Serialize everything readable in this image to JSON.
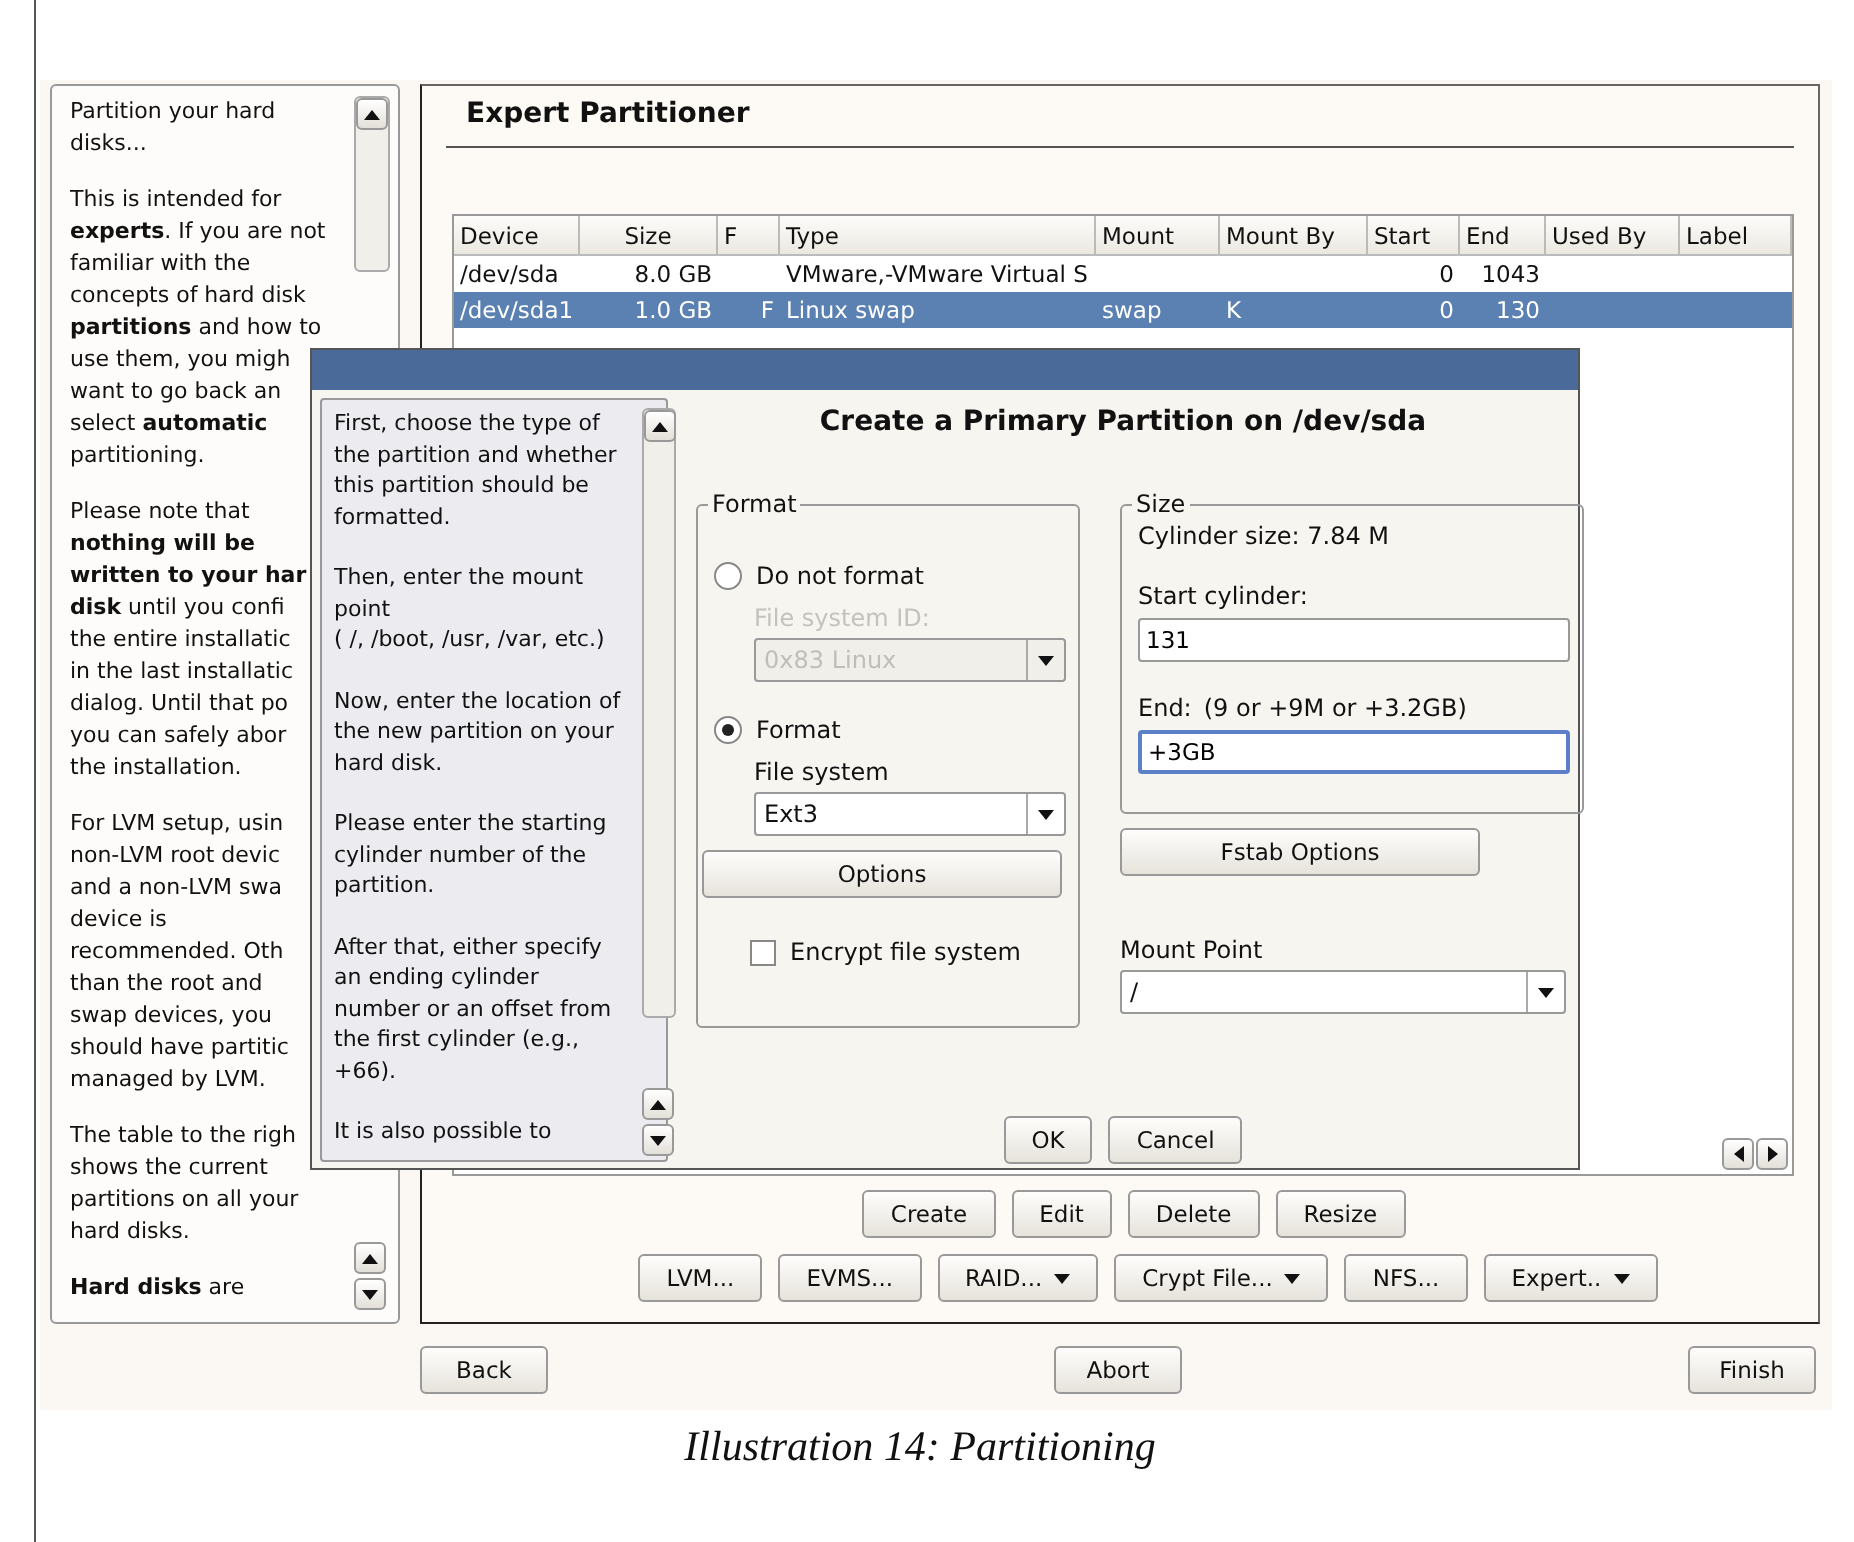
{
  "help": {
    "paragraphs": [
      [
        "Partition your hard",
        "disks..."
      ],
      [
        "This is intended for",
        "**experts**. If you are not",
        "familiar with the",
        "concepts of hard disk",
        "**partitions** and how to",
        "use them, you migh",
        "want to go back an",
        "select **automatic**",
        "partitioning."
      ],
      [
        "Please note that",
        "**nothing will be**",
        "**written to your har**",
        "**disk** until you confi",
        "the entire installatic",
        "in the last installatic",
        "dialog. Until that po",
        "you can safely abor",
        "the installation."
      ],
      [
        "For LVM setup, usin",
        "non-LVM root devic",
        "and a non-LVM swa",
        "device is",
        "recommended. Oth",
        "than the root and",
        "swap devices, you",
        "should have partitic",
        "managed by LVM."
      ],
      [
        "The table to the righ",
        "shows the current",
        "partitions on all your",
        "hard disks."
      ],
      [
        "**Hard disks** are"
      ]
    ]
  },
  "main": {
    "title": "Expert Partitioner",
    "table": {
      "columns": [
        "Device",
        "Size",
        "F",
        "Type",
        "Mount",
        "Mount By",
        "Start",
        "End",
        "Used By",
        "Label"
      ],
      "rows": [
        {
          "cells": [
            "/dev/sda",
            "8.0 GB",
            null,
            "VMware,-VMware Virtual S",
            null,
            null,
            "0",
            "1043",
            null,
            null
          ],
          "selected": false
        },
        {
          "cells": [
            "/dev/sda1",
            "1.0 GB",
            "F",
            "Linux swap",
            "swap",
            "K",
            "0",
            "130",
            null,
            null
          ],
          "selected": true
        }
      ]
    },
    "action_buttons": [
      {
        "label": "Create"
      },
      {
        "label": "Edit"
      },
      {
        "label": "Delete"
      },
      {
        "label": "Resize"
      }
    ],
    "tool_buttons": [
      {
        "label": "LVM...",
        "menu": false
      },
      {
        "label": "EVMS...",
        "menu": false
      },
      {
        "label": "RAID...",
        "menu": true
      },
      {
        "label": "Crypt File...",
        "menu": true
      },
      {
        "label": "NFS...",
        "menu": false
      },
      {
        "label": "Expert..",
        "menu": true
      }
    ]
  },
  "nav_buttons": [
    {
      "label": "Back"
    },
    {
      "label": "Abort"
    },
    {
      "label": "Finish"
    }
  ],
  "dialog": {
    "heading": "Create a Primary Partition on /dev/sda",
    "help": {
      "paragraphs": [
        "First, choose the type of the partition and whether this partition should be formatted.",
        "Then, enter the mount point\n( /, /boot, /usr, /var, etc.)",
        "Now, enter the location of the new partition on your hard disk.",
        "Please enter the starting cylinder number of the partition.",
        "After that, either specify an ending cylinder number or an offset from the first cylinder (e.g., +66).",
        "It is also possible to"
      ]
    },
    "format": {
      "label": "Format",
      "options": [
        {
          "label": "Do not format",
          "selected": false
        },
        {
          "label": "Format",
          "selected": true
        }
      ],
      "fs_id": {
        "label": "File system ID:",
        "value": "0x83 Linux",
        "disabled": true
      },
      "file_system": {
        "label": "File system",
        "value": "Ext3",
        "disabled": false
      },
      "options_button": {
        "label": "Options"
      },
      "encrypt": {
        "label": "Encrypt file system",
        "checked": false
      }
    },
    "size": {
      "label": "Size",
      "cylinder_size": "Cylinder size: 7.84 M",
      "start": {
        "label": "Start cylinder:",
        "value": "131",
        "focused": false
      },
      "end": {
        "label": "End:",
        "hint": "(9 or +9M or +3.2GB)",
        "value": "+3GB",
        "focused": true
      }
    },
    "fstab_button": {
      "label": "Fstab Options"
    },
    "mount_point": {
      "label": "Mount Point",
      "value": "/"
    },
    "buttons": [
      {
        "label": "OK"
      },
      {
        "label": "Cancel"
      }
    ]
  },
  "caption": "Illustration 14: Partitioning"
}
